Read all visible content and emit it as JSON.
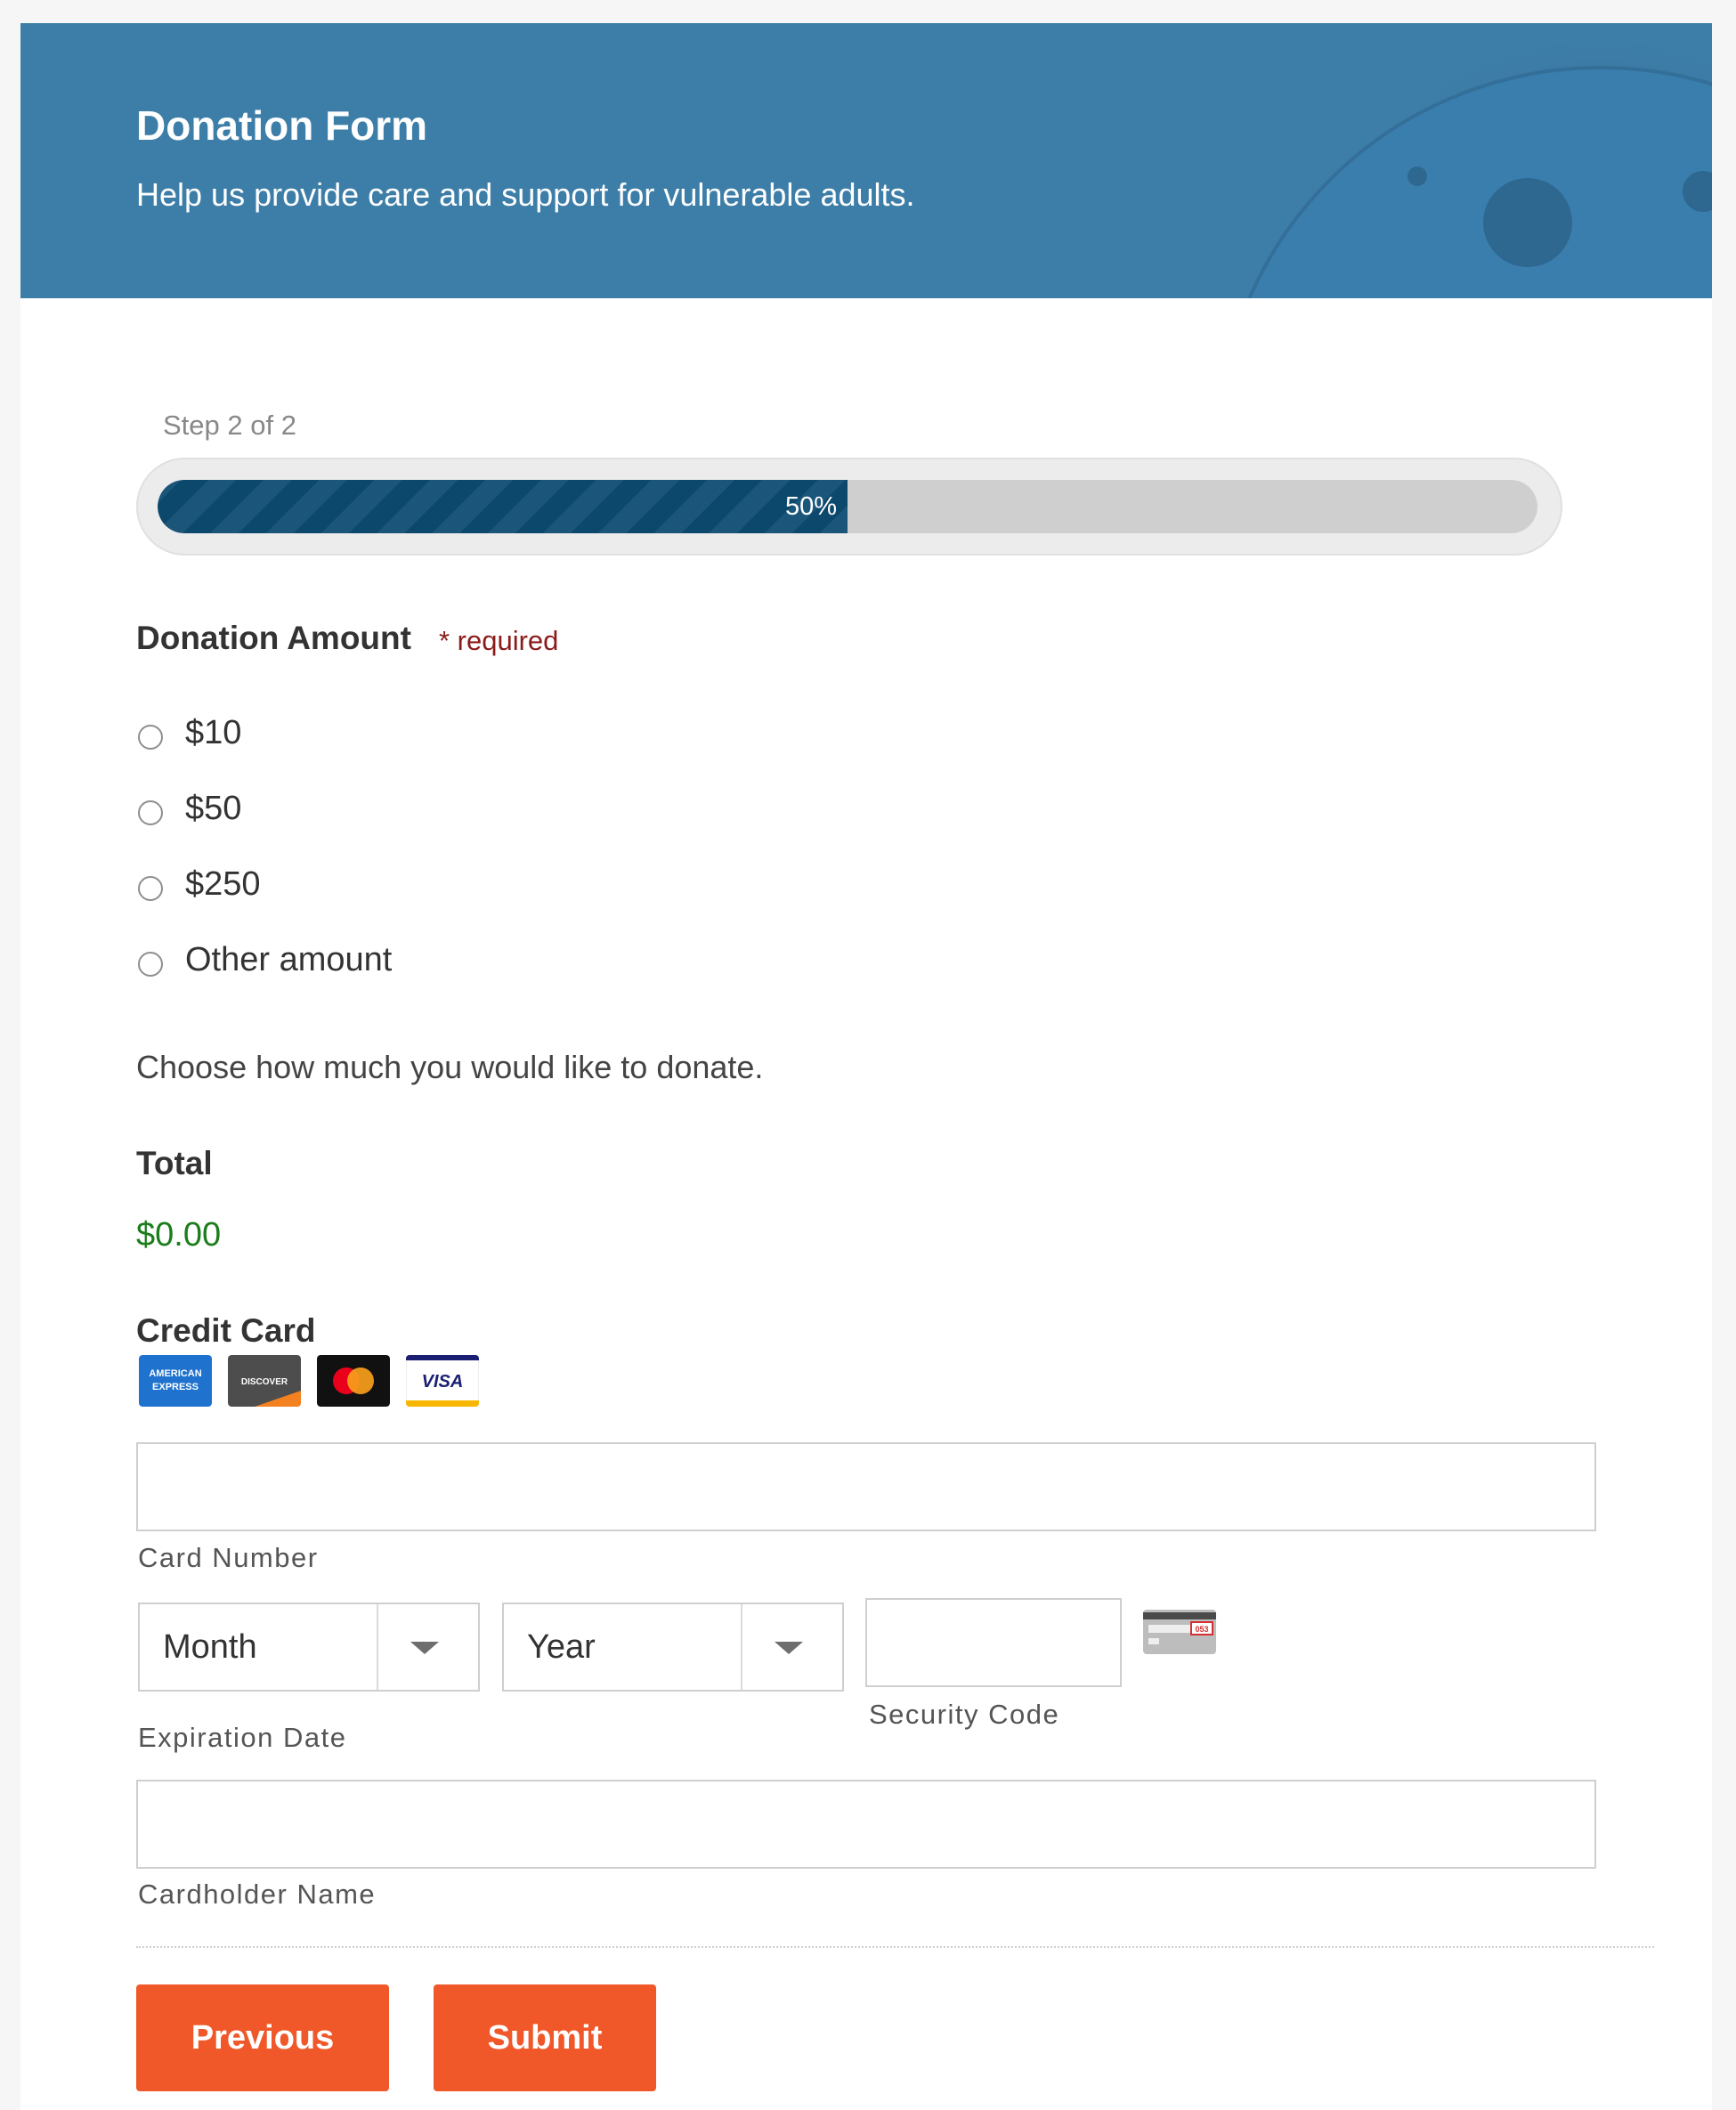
{
  "header": {
    "title": "Donation Form",
    "subtitle": "Help us provide care and support for vulnerable adults.",
    "background_color": "#3d7ea8"
  },
  "progress": {
    "step_label": "Step 2 of 2",
    "percent": 50,
    "percent_label": "50%"
  },
  "donation": {
    "label": "Donation Amount",
    "required_text": "* required",
    "options": [
      "$10",
      "$50",
      "$250",
      "Other amount"
    ],
    "help": "Choose how much you would like to donate."
  },
  "total": {
    "label": "Total",
    "value": "$0.00"
  },
  "credit_card": {
    "label": "Credit Card",
    "logos": [
      {
        "name": "american-express-icon",
        "text": "AMERICAN EXPRESS"
      },
      {
        "name": "discover-icon",
        "text": "DISCOVER"
      },
      {
        "name": "mastercard-icon",
        "text": ""
      },
      {
        "name": "visa-icon",
        "text": "VISA"
      }
    ],
    "card_number_label": "Card Number",
    "month_value": "Month",
    "year_value": "Year",
    "expiration_label": "Expiration Date",
    "security_label": "Security Code",
    "cvv_example": "053",
    "cardholder_label": "Cardholder Name"
  },
  "buttons": {
    "previous": "Previous",
    "submit": "Submit",
    "color": "#f0582a"
  }
}
